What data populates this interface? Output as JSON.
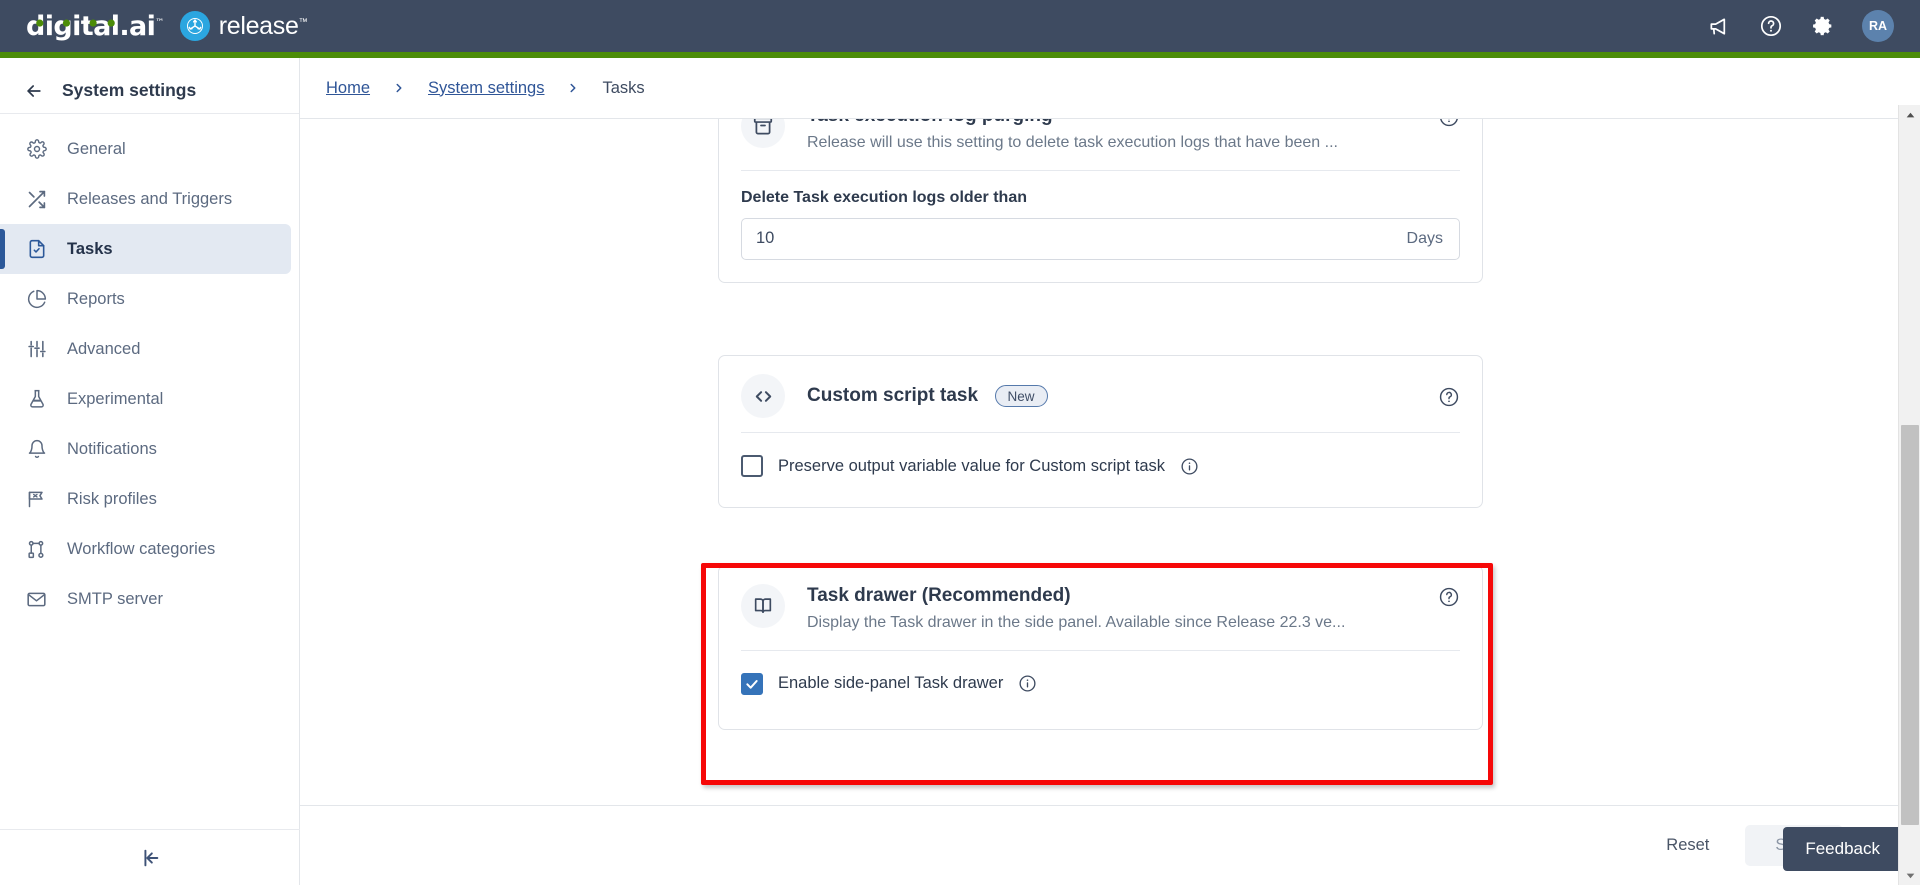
{
  "header": {
    "logo_primary": "digital.ai",
    "logo_tm": "™",
    "logo_secondary": "release",
    "icons": [
      "announcement-icon",
      "help-icon",
      "settings-icon"
    ],
    "avatar_initials": "RA",
    "accent_green": "#4c8c08",
    "bar_color": "#3e4b61"
  },
  "sidebar": {
    "title": "System settings",
    "back_label": "back-arrow",
    "items": [
      {
        "label": "General",
        "icon": "gear-icon",
        "active": false
      },
      {
        "label": "Releases and Triggers",
        "icon": "shuffle-icon",
        "active": false
      },
      {
        "label": "Tasks",
        "icon": "task-document-icon",
        "active": true
      },
      {
        "label": "Reports",
        "icon": "pie-chart-icon",
        "active": false
      },
      {
        "label": "Advanced",
        "icon": "sliders-icon",
        "active": false
      },
      {
        "label": "Experimental",
        "icon": "flask-icon",
        "active": false
      },
      {
        "label": "Notifications",
        "icon": "bell-icon",
        "active": false
      },
      {
        "label": "Risk profiles",
        "icon": "risk-flag-icon",
        "active": false
      },
      {
        "label": "Workflow categories",
        "icon": "workflow-nodes-icon",
        "active": false
      },
      {
        "label": "SMTP server",
        "icon": "envelope-icon",
        "active": false
      }
    ],
    "collapse_icon": "collapse-sidebar-icon"
  },
  "breadcrumb": {
    "items": [
      "Home",
      "System settings",
      "Tasks"
    ],
    "separator": "chevron-right-icon"
  },
  "cards": [
    {
      "id": "task-execution-log-purging",
      "icon": "archive-box-icon",
      "title": "Task execution log purging",
      "subtitle": "Release will use this setting to delete task execution logs that have been ...",
      "help_icon": "question-circle-icon",
      "field_label": "Delete Task execution logs older than",
      "field_value": "10",
      "field_suffix": "Days",
      "highlighted": false
    },
    {
      "id": "custom-script-task",
      "icon": "code-brackets-icon",
      "title": "Custom script task",
      "badge": "New",
      "help_icon": "question-circle-icon",
      "checkbox_label": "Preserve output variable value for Custom script task",
      "checkbox_checked": false,
      "info_icon": "info-circle-icon",
      "highlighted": false
    },
    {
      "id": "task-drawer",
      "icon": "book-open-icon",
      "title": "Task drawer (Recommended)",
      "subtitle": "Display the Task drawer in the side panel. Available since Release 22.3 ve...",
      "help_icon": "question-circle-icon",
      "checkbox_label": "Enable side-panel Task drawer",
      "checkbox_checked": true,
      "info_icon": "info-circle-icon",
      "highlighted": true,
      "highlight_color": "#f60808"
    }
  ],
  "footer": {
    "reset_label": "Reset",
    "save_label": "Save",
    "feedback_label": "Feedback"
  },
  "scrollbar": {
    "up_icon": "scroll-up-arrow-icon",
    "down_icon": "scroll-down-arrow-icon"
  }
}
